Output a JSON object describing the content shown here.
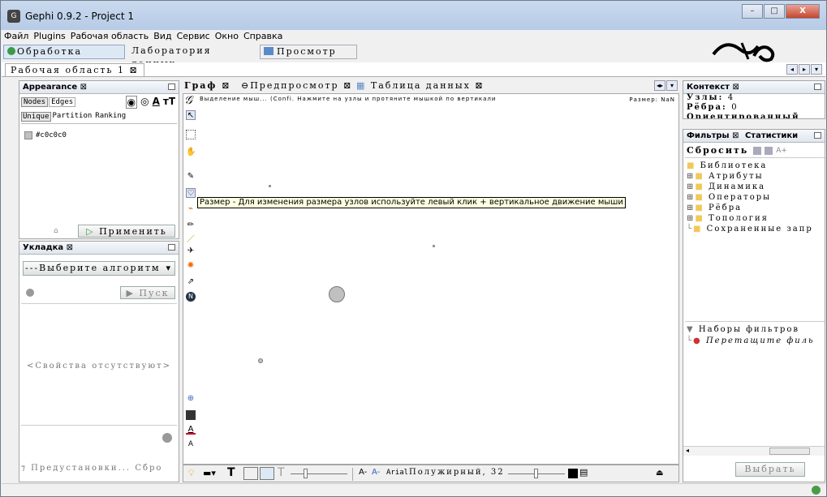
{
  "window": {
    "title": "Gephi 0.9.2 - Project 1",
    "minimize": "–",
    "maximize": "□",
    "close": "X"
  },
  "menu": [
    "Файл",
    "Plugins",
    "Рабочая область",
    "Вид",
    "Сервис",
    "Окно",
    "Справка"
  ],
  "toolbar": {
    "overview": "Обработка",
    "datalab": "Лаборатория данных",
    "preview": "Просмотр"
  },
  "workspace_tab": "Рабочая область 1",
  "appearance": {
    "title": "Appearance",
    "tabs": [
      "Nodes",
      "Edges"
    ],
    "subtabs": [
      "Unique",
      "Partition",
      "Ranking"
    ],
    "color_value": "#c0c0c0",
    "apply": "Применить"
  },
  "layout": {
    "title": "Укладка",
    "select": "---Выберите алгоритм",
    "run": "Пуск",
    "no_props": "<Свойства отсутствуют>",
    "presets": "Предустановки...",
    "reset": "Сбро"
  },
  "center_tabs": {
    "graph": "Граф",
    "preview": "Предпросмотр",
    "table": "Таблица данных"
  },
  "hint": "Выделение мыш... (Confi. Нажмите на узлы и протяните мышкой по вертикали",
  "hint_right": "Размер: NaN",
  "tooltip": "Размер - Для изменения размера узлов используйте левый клик + вертикальное движение мыши",
  "bottom_toolbar": {
    "font_a": "A-",
    "font_b": "A-",
    "font_name": "Arial",
    "font_style": "Полужирный, 32"
  },
  "context": {
    "title": "Контекст",
    "nodes_label": "Узлы:",
    "nodes_value": "4",
    "edges_label": "Рёбра:",
    "edges_value": "0",
    "type": "Ориентированный"
  },
  "filters": {
    "tab1": "Фильтры",
    "tab2": "Статистики",
    "reset": "Сбросить",
    "library": "Библиотека",
    "items": [
      "Атрибуты",
      "Динамика",
      "Операторы",
      "Рёбра",
      "Топология",
      "Сохраненные запр"
    ],
    "sets_title": "Наборы фильтров",
    "drag_hint": "Перетащите филь",
    "choose": "Выбрать"
  },
  "colors": {
    "node": "#c0c0c0",
    "titlebar": "#c9d9ee",
    "folder": "#f1c85a"
  }
}
